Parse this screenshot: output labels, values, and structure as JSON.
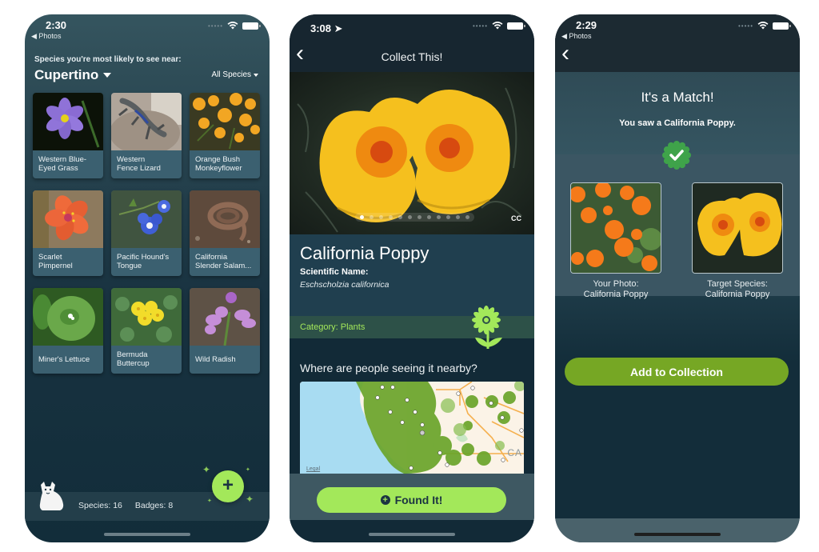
{
  "screen1": {
    "status": {
      "time": "2:30",
      "back_app": "◀ Photos"
    },
    "near_label": "Species you're most likely to see near:",
    "location": "Cupertino",
    "filter": "All Species",
    "species": [
      {
        "name": "Western Blue-Eyed Grass",
        "line1": "Western Blue-",
        "line2": "Eyed Grass"
      },
      {
        "name": "Western Fence Lizard",
        "line1": "Western",
        "line2": "Fence Lizard"
      },
      {
        "name": "Orange Bush Monkeyflower",
        "line1": "Orange Bush",
        "line2": "Monkeyflower"
      },
      {
        "name": "Scarlet Pimpernel",
        "line1": "Scarlet",
        "line2": "Pimpernel"
      },
      {
        "name": "Pacific Hound's Tongue",
        "line1": "Pacific Hound's",
        "line2": "Tongue"
      },
      {
        "name": "California Slender Salamander",
        "line1": "California",
        "line2": "Slender Salam..."
      },
      {
        "name": "Miner's Lettuce",
        "line1": "Miner's Lettuce",
        "line2": ""
      },
      {
        "name": "Bermuda Buttercup",
        "line1": "Bermuda",
        "line2": "Buttercup"
      },
      {
        "name": "Wild Radish",
        "line1": "Wild Radish",
        "line2": ""
      }
    ],
    "stats": {
      "species": "Species: 16",
      "badges": "Badges: 8"
    },
    "fab_label": "+"
  },
  "screen2": {
    "status": {
      "time": "3:08 ➤"
    },
    "title": "Collect This!",
    "back": "‹",
    "photo_count": 12,
    "photo_index": 1,
    "cc_label": "CC",
    "species_name": "California Poppy",
    "scientific_label": "Scientific Name:",
    "scientific_name": "Eschscholzia californica",
    "category": "Category: Plants",
    "nearby_heading": "Where are people seeing it nearby?",
    "map_legal": "Legal",
    "map_label": "CA",
    "found_button": "Found It!",
    "found_icon": "+"
  },
  "screen3": {
    "status": {
      "time": "2:29",
      "back_app": "◀ Photos"
    },
    "back": "‹",
    "title": "It's a Match!",
    "subtitle": "You saw a California Poppy.",
    "your_photo": {
      "line1": "Your Photo:",
      "line2": "California Poppy"
    },
    "target": {
      "line1": "Target Species:",
      "line2": "California Poppy"
    },
    "add_button": "Add to Collection"
  },
  "colors": {
    "accent_lime": "#a3e85a",
    "accent_green": "#76a724",
    "navy": "#122a37",
    "card": "#3b6070"
  }
}
